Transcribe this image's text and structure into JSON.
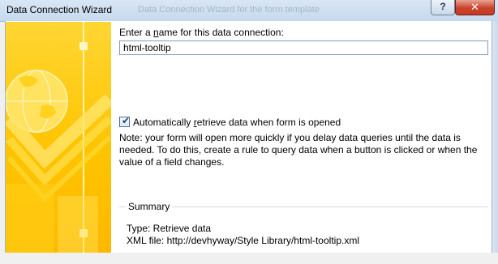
{
  "window": {
    "title": "Data Connection Wizard",
    "ghost_title": "Data Connection Wizard for the form template",
    "help_glyph": "?",
    "close_glyph": "✕"
  },
  "form": {
    "name_label_pre": "Enter a ",
    "name_label_access": "n",
    "name_label_post": "ame for this data connection:",
    "name_value": "html-tooltip",
    "auto_retrieve_pre": "Automatically ",
    "auto_retrieve_access": "r",
    "auto_retrieve_post": "etrieve data when form is opened",
    "auto_retrieve_checked": true,
    "checkmark": "✔",
    "note": "Note: your form will open more quickly if you delay data queries until the data is needed. To do this, create a rule to query data when a button is clicked or when the value of a field changes."
  },
  "summary": {
    "title": "Summary",
    "type_line": "Type: Retrieve data",
    "xml_line": "XML file: http://devhyway/Style Library/html-tooltip.xml"
  },
  "colors": {
    "art_yellow": "#ffc400",
    "title_bar": "#c5d9ee",
    "close_red": "#c73b22"
  }
}
